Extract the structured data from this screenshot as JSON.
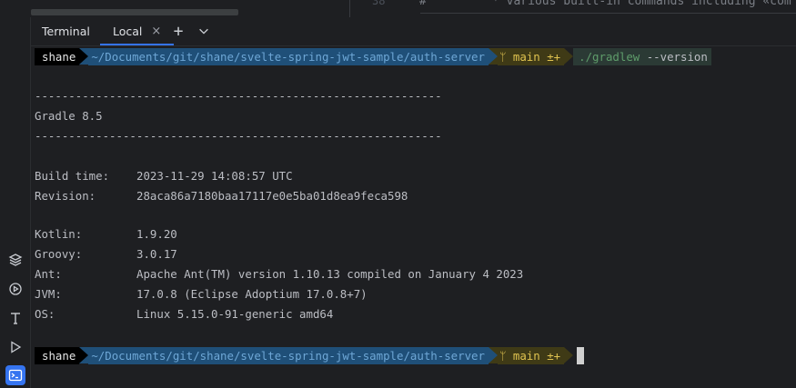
{
  "editor": {
    "line_number": "38",
    "hash": "#",
    "comment": "*   various built-in commands including «com"
  },
  "tabs": [
    {
      "label": "Terminal"
    },
    {
      "label": "Local",
      "close": "×"
    }
  ],
  "tab_actions": {
    "add": "+",
    "dropdown": "⌄"
  },
  "prompt": {
    "user": "shane",
    "path": "~/Documents/git/shane/svelte-spring-jwt-sample/auth-server",
    "git_icon": "ᛘ",
    "branch": "main ±+",
    "command_bin": "./gradlew",
    "command_args": " --version"
  },
  "output": {
    "rule": "------------------------------------------------------------",
    "gradle": "Gradle 8.5",
    "rows": [
      {
        "key": "Build time:",
        "value": "2023-11-29 14:08:57 UTC"
      },
      {
        "key": "Revision:",
        "value": "28aca86a7180baa17117e0e5ba01d8ea9feca598"
      },
      {
        "key": "Kotlin:",
        "value": "1.9.20"
      },
      {
        "key": "Groovy:",
        "value": "3.0.17"
      },
      {
        "key": "Ant:",
        "value": "Apache Ant(TM) version 1.10.13 compiled on January 4 2023"
      },
      {
        "key": "JVM:",
        "value": "17.0.8 (Eclipse Adoptium 17.0.8+7)"
      },
      {
        "key": "OS:",
        "value": "Linux 5.15.0-91-generic amd64"
      }
    ]
  },
  "left_tools": [
    "layers-icon",
    "services-icon",
    "text-icon",
    "run-icon",
    "terminal-icon"
  ]
}
